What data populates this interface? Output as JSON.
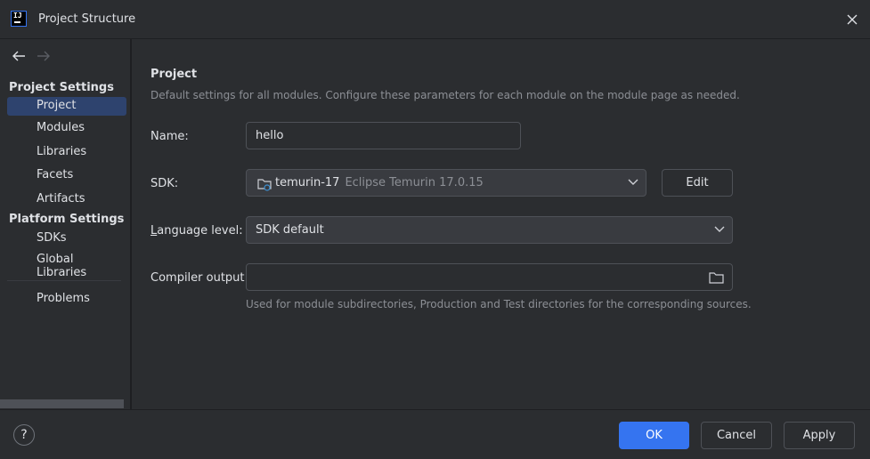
{
  "window": {
    "title": "Project Structure",
    "app_icon": "intellij-logo-icon",
    "app_icon_text": "IJ"
  },
  "sidebar": {
    "sections": [
      {
        "title": "Project Settings"
      },
      {
        "title": "Platform Settings"
      }
    ],
    "items": [
      {
        "label": "Project",
        "selected": true
      },
      {
        "label": "Modules"
      },
      {
        "label": "Libraries"
      },
      {
        "label": "Facets"
      },
      {
        "label": "Artifacts"
      },
      {
        "label": "SDKs"
      },
      {
        "label": "Global Libraries"
      },
      {
        "label": "Problems"
      }
    ]
  },
  "main": {
    "heading": "Project",
    "description": "Default settings for all modules. Configure these parameters for each module on the module page as needed.",
    "name_label": "Name:",
    "name_value": "hello",
    "sdk_label": "SDK:",
    "sdk_name": "temurin-17",
    "sdk_detail": "Eclipse Temurin 17.0.15",
    "edit_label": "Edit",
    "language_label_prefix": "L",
    "language_label_rest": "anguage level:",
    "language_value": "SDK default",
    "compiler_label": "Compiler output:",
    "compiler_value": "",
    "compiler_hint": "Used for module subdirectories, Production and Test directories for the corresponding sources."
  },
  "footer": {
    "help_label": "?",
    "ok_label": "OK",
    "cancel_label": "Cancel",
    "apply_label": "Apply"
  },
  "colors": {
    "accent": "#3574f0",
    "selection": "#2e436e",
    "background": "#2b2d30"
  }
}
